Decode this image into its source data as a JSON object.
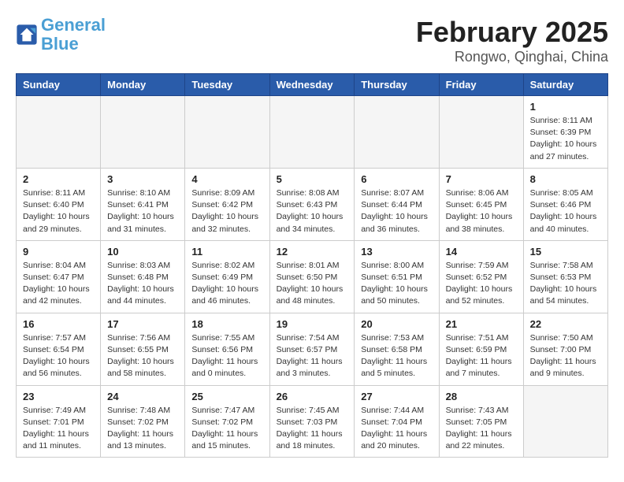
{
  "logo": {
    "line1": "General",
    "line2": "Blue"
  },
  "title": "February 2025",
  "subtitle": "Rongwo, Qinghai, China",
  "headers": [
    "Sunday",
    "Monday",
    "Tuesday",
    "Wednesday",
    "Thursday",
    "Friday",
    "Saturday"
  ],
  "weeks": [
    [
      {
        "day": "",
        "info": ""
      },
      {
        "day": "",
        "info": ""
      },
      {
        "day": "",
        "info": ""
      },
      {
        "day": "",
        "info": ""
      },
      {
        "day": "",
        "info": ""
      },
      {
        "day": "",
        "info": ""
      },
      {
        "day": "1",
        "info": "Sunrise: 8:11 AM\nSunset: 6:39 PM\nDaylight: 10 hours\nand 27 minutes."
      }
    ],
    [
      {
        "day": "2",
        "info": "Sunrise: 8:11 AM\nSunset: 6:40 PM\nDaylight: 10 hours\nand 29 minutes."
      },
      {
        "day": "3",
        "info": "Sunrise: 8:10 AM\nSunset: 6:41 PM\nDaylight: 10 hours\nand 31 minutes."
      },
      {
        "day": "4",
        "info": "Sunrise: 8:09 AM\nSunset: 6:42 PM\nDaylight: 10 hours\nand 32 minutes."
      },
      {
        "day": "5",
        "info": "Sunrise: 8:08 AM\nSunset: 6:43 PM\nDaylight: 10 hours\nand 34 minutes."
      },
      {
        "day": "6",
        "info": "Sunrise: 8:07 AM\nSunset: 6:44 PM\nDaylight: 10 hours\nand 36 minutes."
      },
      {
        "day": "7",
        "info": "Sunrise: 8:06 AM\nSunset: 6:45 PM\nDaylight: 10 hours\nand 38 minutes."
      },
      {
        "day": "8",
        "info": "Sunrise: 8:05 AM\nSunset: 6:46 PM\nDaylight: 10 hours\nand 40 minutes."
      }
    ],
    [
      {
        "day": "9",
        "info": "Sunrise: 8:04 AM\nSunset: 6:47 PM\nDaylight: 10 hours\nand 42 minutes."
      },
      {
        "day": "10",
        "info": "Sunrise: 8:03 AM\nSunset: 6:48 PM\nDaylight: 10 hours\nand 44 minutes."
      },
      {
        "day": "11",
        "info": "Sunrise: 8:02 AM\nSunset: 6:49 PM\nDaylight: 10 hours\nand 46 minutes."
      },
      {
        "day": "12",
        "info": "Sunrise: 8:01 AM\nSunset: 6:50 PM\nDaylight: 10 hours\nand 48 minutes."
      },
      {
        "day": "13",
        "info": "Sunrise: 8:00 AM\nSunset: 6:51 PM\nDaylight: 10 hours\nand 50 minutes."
      },
      {
        "day": "14",
        "info": "Sunrise: 7:59 AM\nSunset: 6:52 PM\nDaylight: 10 hours\nand 52 minutes."
      },
      {
        "day": "15",
        "info": "Sunrise: 7:58 AM\nSunset: 6:53 PM\nDaylight: 10 hours\nand 54 minutes."
      }
    ],
    [
      {
        "day": "16",
        "info": "Sunrise: 7:57 AM\nSunset: 6:54 PM\nDaylight: 10 hours\nand 56 minutes."
      },
      {
        "day": "17",
        "info": "Sunrise: 7:56 AM\nSunset: 6:55 PM\nDaylight: 10 hours\nand 58 minutes."
      },
      {
        "day": "18",
        "info": "Sunrise: 7:55 AM\nSunset: 6:56 PM\nDaylight: 11 hours\nand 0 minutes."
      },
      {
        "day": "19",
        "info": "Sunrise: 7:54 AM\nSunset: 6:57 PM\nDaylight: 11 hours\nand 3 minutes."
      },
      {
        "day": "20",
        "info": "Sunrise: 7:53 AM\nSunset: 6:58 PM\nDaylight: 11 hours\nand 5 minutes."
      },
      {
        "day": "21",
        "info": "Sunrise: 7:51 AM\nSunset: 6:59 PM\nDaylight: 11 hours\nand 7 minutes."
      },
      {
        "day": "22",
        "info": "Sunrise: 7:50 AM\nSunset: 7:00 PM\nDaylight: 11 hours\nand 9 minutes."
      }
    ],
    [
      {
        "day": "23",
        "info": "Sunrise: 7:49 AM\nSunset: 7:01 PM\nDaylight: 11 hours\nand 11 minutes."
      },
      {
        "day": "24",
        "info": "Sunrise: 7:48 AM\nSunset: 7:02 PM\nDaylight: 11 hours\nand 13 minutes."
      },
      {
        "day": "25",
        "info": "Sunrise: 7:47 AM\nSunset: 7:02 PM\nDaylight: 11 hours\nand 15 minutes."
      },
      {
        "day": "26",
        "info": "Sunrise: 7:45 AM\nSunset: 7:03 PM\nDaylight: 11 hours\nand 18 minutes."
      },
      {
        "day": "27",
        "info": "Sunrise: 7:44 AM\nSunset: 7:04 PM\nDaylight: 11 hours\nand 20 minutes."
      },
      {
        "day": "28",
        "info": "Sunrise: 7:43 AM\nSunset: 7:05 PM\nDaylight: 11 hours\nand 22 minutes."
      },
      {
        "day": "",
        "info": ""
      }
    ]
  ]
}
